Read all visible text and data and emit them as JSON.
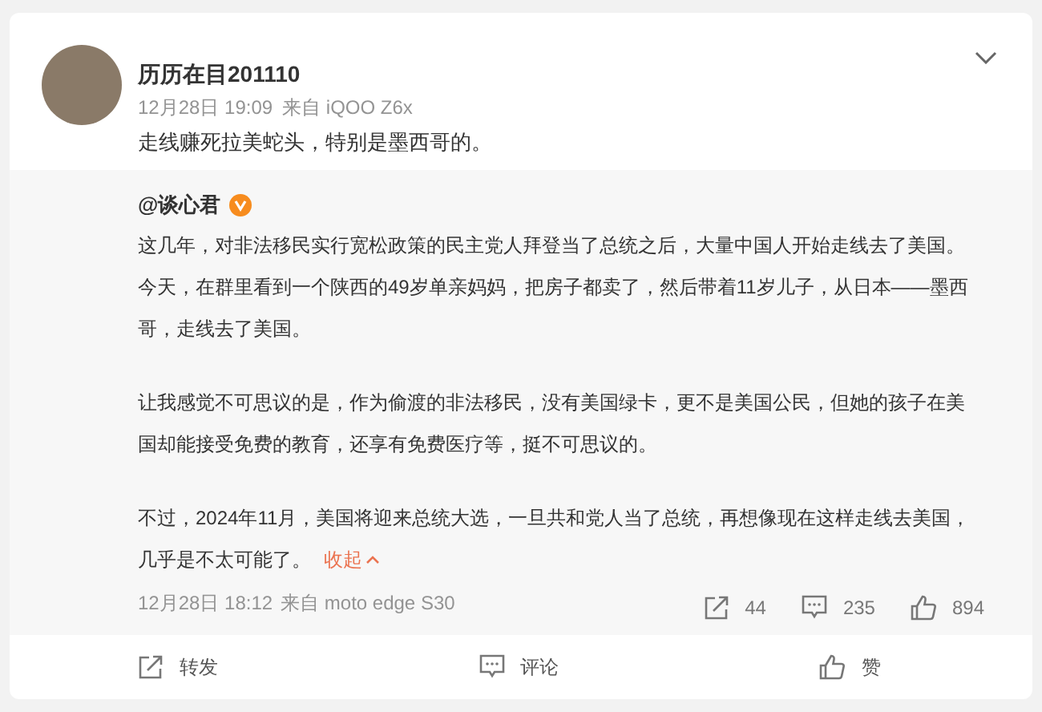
{
  "post": {
    "author": "历历在目201110",
    "time": "12月28日 19:09",
    "source": "来自 iQOO Z6x",
    "text": "走线赚死拉美蛇头，特别是墨西哥的。"
  },
  "repost": {
    "author": "@谈心君",
    "verified": true,
    "paragraphs": [
      {
        "lines": [
          "这几年，对非法移民实行宽松政策的民主党人拜登当了总统之后，大量中国人开始走线去了美国。",
          "今天，在群里看到一个陕西的49岁单亲妈妈，把房子都卖了，然后带着11岁儿子，从日本——墨西哥，走线去了美国。"
        ]
      },
      {
        "lines": [
          "让我感觉不可思议的是，作为偷渡的非法移民，没有美国绿卡，更不是美国公民，但她的孩子在美国却能接受免费的教育，还享有免费医疗等，挺不可思议的。"
        ]
      },
      {
        "lines": [
          "不过，2024年11月，美国将迎来总统大选，一旦共和党人当了总统，再想像现在这样走线去美国，几乎是不太可能了。"
        ]
      }
    ],
    "collapse_link": "收起",
    "time": "12月28日 18:12",
    "source": "来自 moto edge S30",
    "stats": [
      {
        "kind": "share",
        "count": "44"
      },
      {
        "kind": "comment",
        "count": "235"
      },
      {
        "kind": "like",
        "count": "894"
      }
    ]
  },
  "actions": [
    {
      "kind": "share",
      "label": "转发"
    },
    {
      "kind": "comment",
      "label": "评论"
    },
    {
      "kind": "like",
      "label": "赞"
    }
  ]
}
